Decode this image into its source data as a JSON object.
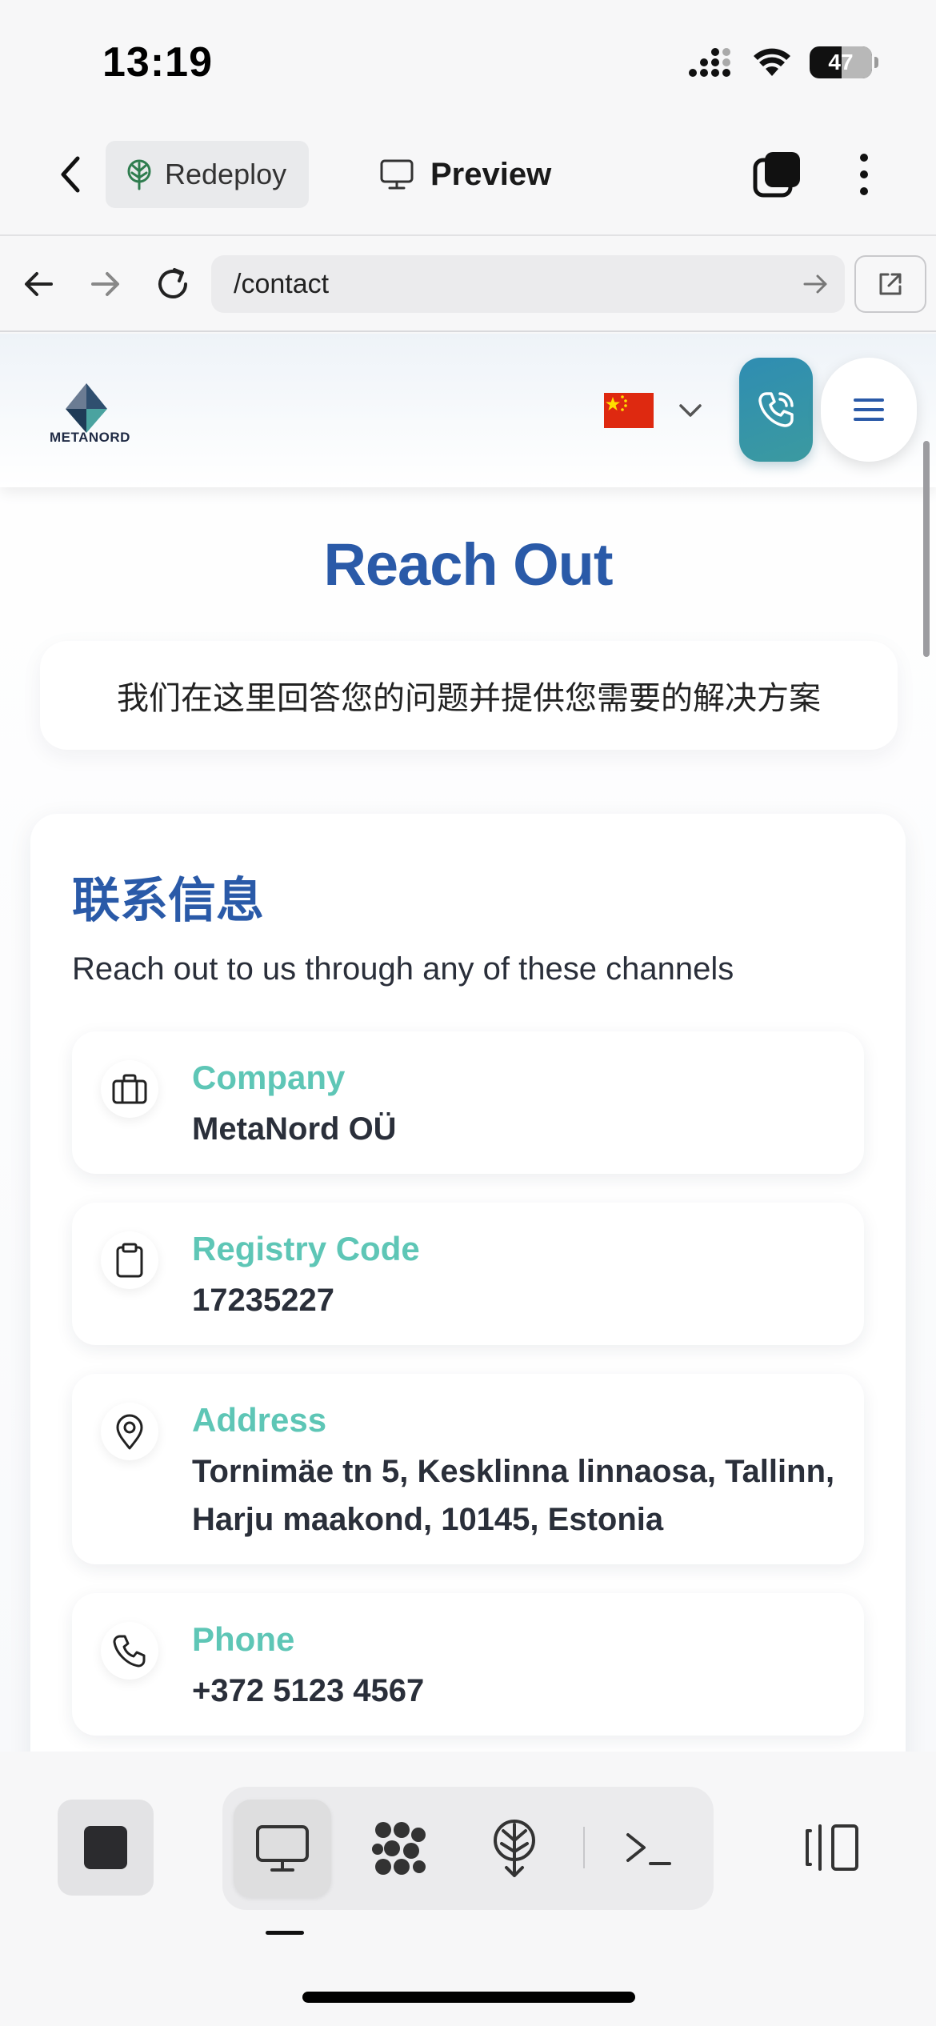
{
  "status_bar": {
    "time": "13:19",
    "battery": "47"
  },
  "app_bar": {
    "redeploy_label": "Redeploy",
    "preview_label": "Preview"
  },
  "browser": {
    "url": "/contact"
  },
  "site": {
    "logo_text": "METANORD",
    "language_flag": "china-flag",
    "title": "Reach Out",
    "subtitle": "我们在这里回答您的问题并提供您需要的解决方案",
    "contact": {
      "heading": "联系信息",
      "description": "Reach out to us through any of these channels",
      "items": [
        {
          "icon": "briefcase-icon",
          "label": "Company",
          "value": "MetaNord OÜ"
        },
        {
          "icon": "clipboard-icon",
          "label": "Registry Code",
          "value": "17235227"
        },
        {
          "icon": "map-pin-icon",
          "label": "Address",
          "value": "Tornimäe tn 5, Kesklinna linnaosa, Tallinn, Harju maakond, 10145, Estonia"
        },
        {
          "icon": "phone-icon",
          "label": "Phone",
          "value": "+372 5123 4567"
        }
      ]
    }
  },
  "bottom_bar": {
    "active_view": "preview",
    "views": [
      "preview-desktop-icon",
      "nodes-icon",
      "deploy-icon",
      "terminal-icon"
    ]
  },
  "colors": {
    "title_blue": "#2a5aa8",
    "label_teal": "#5ec6b6",
    "call_button": "#2f8db2",
    "flag_red": "#de2910"
  }
}
